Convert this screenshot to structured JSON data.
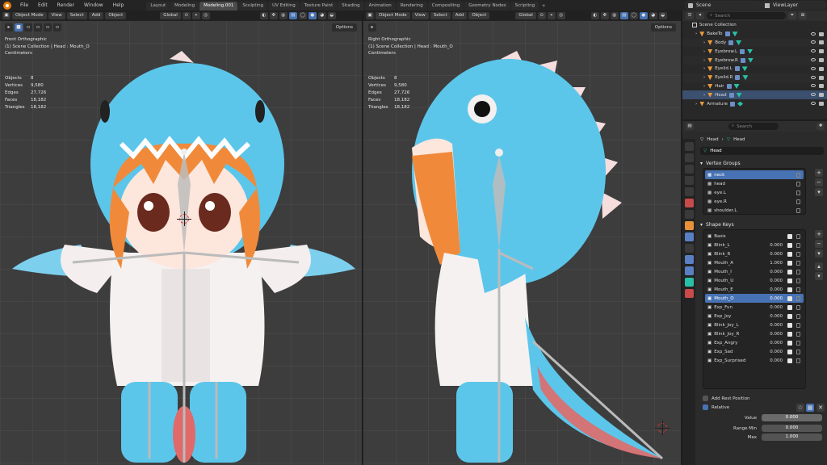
{
  "topbar": {
    "menus": [
      "File",
      "Edit",
      "Render",
      "Window",
      "Help"
    ],
    "workspaces": [
      "Layout",
      "Modeling",
      "Modeling.001",
      "Sculpting",
      "UV Editing",
      "Texture Paint",
      "Shading",
      "Animation",
      "Rendering",
      "Compositing",
      "Geometry Nodes",
      "Scripting"
    ],
    "active_workspace": "Modeling.001",
    "add_tab": "+",
    "scene": "Scene",
    "view_layer": "ViewLayer"
  },
  "viewport_left": {
    "mode": "Object Mode",
    "menus": [
      "View",
      "Select",
      "Add",
      "Object"
    ],
    "orientation": "Global",
    "options": "Options",
    "view_name": "Front Orthographic",
    "collection_info": "(1) Scene Collection | Head : Mouth_O",
    "units": "Centimeters",
    "stats": [
      {
        "k": "Objects",
        "v": "8"
      },
      {
        "k": "Vertices",
        "v": "9,580"
      },
      {
        "k": "Edges",
        "v": "27,726"
      },
      {
        "k": "Faces",
        "v": "18,182"
      },
      {
        "k": "Triangles",
        "v": "18,182"
      }
    ]
  },
  "viewport_right": {
    "mode": "Object Mode",
    "menus": [
      "View",
      "Select",
      "Add",
      "Object"
    ],
    "orientation": "Global",
    "options": "Options",
    "view_name": "Right Orthographic",
    "collection_info": "(1) Scene Collection | Head : Mouth_O",
    "units": "Centimeters",
    "stats": [
      {
        "k": "Objects",
        "v": "8"
      },
      {
        "k": "Vertices",
        "v": "9,580"
      },
      {
        "k": "Edges",
        "v": "27,726"
      },
      {
        "k": "Faces",
        "v": "18,182"
      },
      {
        "k": "Triangles",
        "v": "18,182"
      }
    ]
  },
  "outliner": {
    "search_placeholder": "Search",
    "root": "Scene Collection",
    "items": [
      {
        "label": "BakeTo",
        "level": 1,
        "selected": false
      },
      {
        "label": "Body",
        "level": 2,
        "selected": false
      },
      {
        "label": "Eyebrow.L",
        "level": 2,
        "selected": false
      },
      {
        "label": "Eyebrow.R",
        "level": 2,
        "selected": false
      },
      {
        "label": "Eyelid.L",
        "level": 2,
        "selected": false
      },
      {
        "label": "Eyelid.R",
        "level": 2,
        "selected": false
      },
      {
        "label": "Hair",
        "level": 2,
        "selected": false
      },
      {
        "label": "Head",
        "level": 2,
        "selected": true
      },
      {
        "label": "Armature",
        "level": 1,
        "selected": false
      }
    ]
  },
  "properties": {
    "search_placeholder": "Search",
    "breadcrumb_object": "Head",
    "breadcrumb_data": "Head",
    "mesh_name": "Head",
    "vertex_groups_title": "Vertex Groups",
    "vertex_groups": [
      "neck",
      "head",
      "eye.L",
      "eye.R",
      "shoulder.L"
    ],
    "shape_keys_title": "Shape Keys",
    "shape_keys": [
      {
        "name": "Basis",
        "value": ""
      },
      {
        "name": "Blink_L",
        "value": "0.000"
      },
      {
        "name": "Blink_R",
        "value": "0.000"
      },
      {
        "name": "Mouth_A",
        "value": "1.000"
      },
      {
        "name": "Mouth_I",
        "value": "0.000"
      },
      {
        "name": "Mouth_U",
        "value": "0.000"
      },
      {
        "name": "Mouth_E",
        "value": "0.000"
      },
      {
        "name": "Mouth_O",
        "value": "0.000"
      },
      {
        "name": "Exp_Fun",
        "value": "0.000"
      },
      {
        "name": "Exp_Joy",
        "value": "0.000"
      },
      {
        "name": "Blink_Joy_L",
        "value": "0.000"
      },
      {
        "name": "Blink_Joy_R",
        "value": "0.000"
      },
      {
        "name": "Exp_Angry",
        "value": "0.000"
      },
      {
        "name": "Exp_Sad",
        "value": "0.000"
      },
      {
        "name": "Exp_Surprised",
        "value": "0.000"
      }
    ],
    "selected_shape_key": "Mouth_O",
    "add_rest_position": "Add Rest Position",
    "relative": "Relative",
    "value_label": "Value",
    "value": "0.000",
    "range_min_label": "Range Min",
    "range_min": "0.000",
    "max_label": "Max",
    "max": "1.000"
  }
}
